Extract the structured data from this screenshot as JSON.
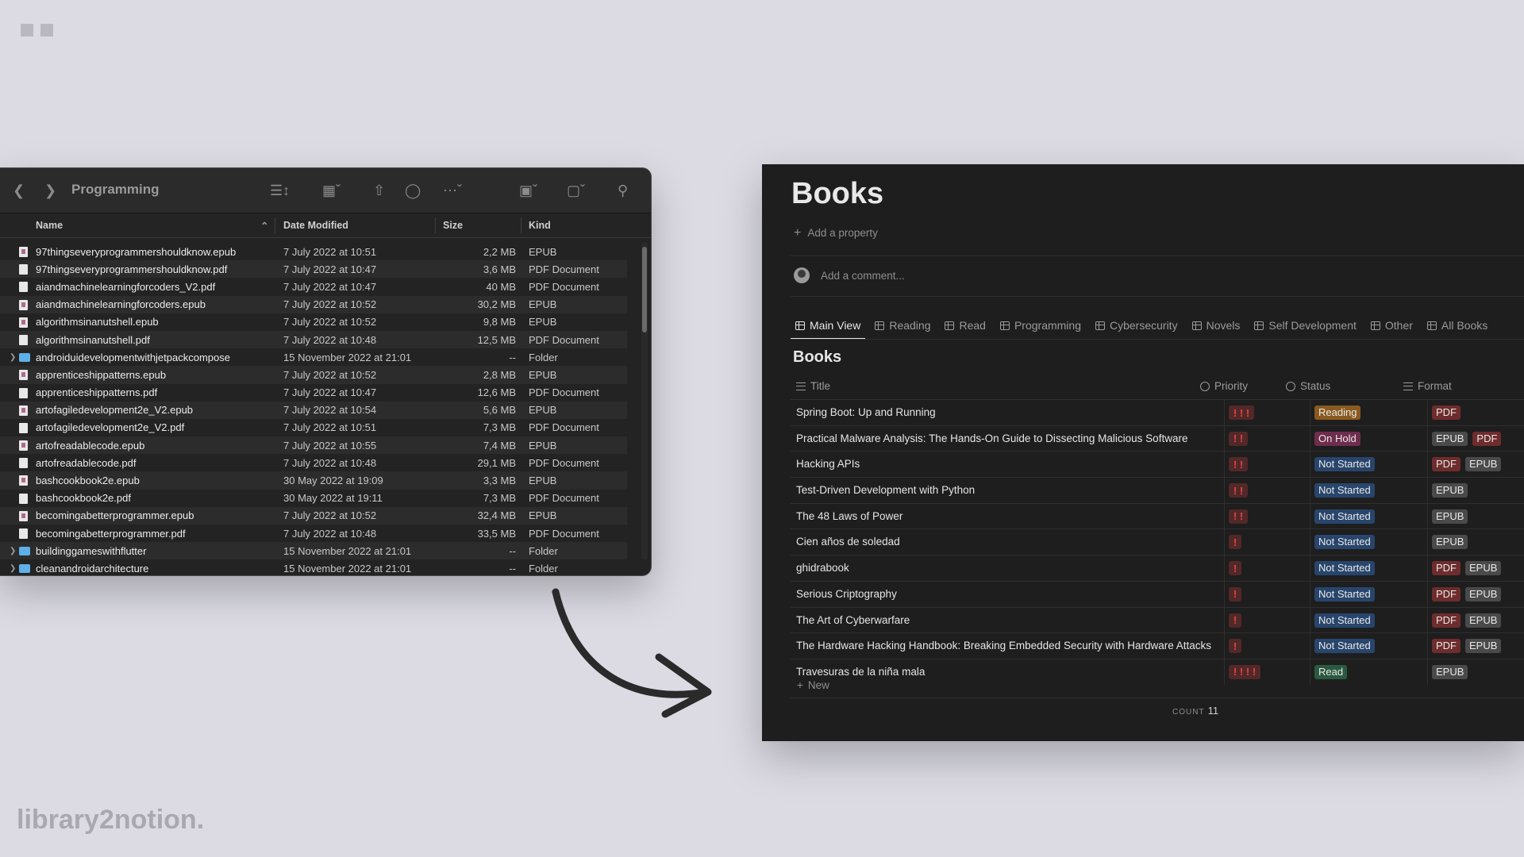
{
  "finder": {
    "title": "Programming",
    "columns": {
      "name": "Name",
      "date": "Date Modified",
      "size": "Size",
      "kind": "Kind"
    },
    "rows": [
      {
        "name": "97thingseveryprogrammershouldknow.epub",
        "date": "7 July 2022 at 10:51",
        "size": "2,2 MB",
        "kind": "EPUB",
        "type": "epub"
      },
      {
        "name": "97thingseveryprogrammershouldknow.pdf",
        "date": "7 July 2022 at 10:47",
        "size": "3,6 MB",
        "kind": "PDF Document",
        "type": "pdf"
      },
      {
        "name": "aiandmachinelearningforcoders_V2.pdf",
        "date": "7 July 2022 at 10:47",
        "size": "40 MB",
        "kind": "PDF Document",
        "type": "pdf"
      },
      {
        "name": "aiandmachinelearningforcoders.epub",
        "date": "7 July 2022 at 10:52",
        "size": "30,2 MB",
        "kind": "EPUB",
        "type": "epub"
      },
      {
        "name": "algorithmsinanutshell.epub",
        "date": "7 July 2022 at 10:52",
        "size": "9,8 MB",
        "kind": "EPUB",
        "type": "epub"
      },
      {
        "name": "algorithmsinanutshell.pdf",
        "date": "7 July 2022 at 10:48",
        "size": "12,5 MB",
        "kind": "PDF Document",
        "type": "pdf"
      },
      {
        "name": "androiduidevelopmentwithjetpackcompose",
        "date": "15 November 2022 at 21:01",
        "size": "--",
        "kind": "Folder",
        "type": "folder"
      },
      {
        "name": "apprenticeshippatterns.epub",
        "date": "7 July 2022 at 10:52",
        "size": "2,8 MB",
        "kind": "EPUB",
        "type": "epub"
      },
      {
        "name": "apprenticeshippatterns.pdf",
        "date": "7 July 2022 at 10:47",
        "size": "12,6 MB",
        "kind": "PDF Document",
        "type": "pdf"
      },
      {
        "name": "artofagiledevelopment2e_V2.epub",
        "date": "7 July 2022 at 10:54",
        "size": "5,6 MB",
        "kind": "EPUB",
        "type": "epub"
      },
      {
        "name": "artofagiledevelopment2e_V2.pdf",
        "date": "7 July 2022 at 10:51",
        "size": "7,3 MB",
        "kind": "PDF Document",
        "type": "pdf"
      },
      {
        "name": "artofreadablecode.epub",
        "date": "7 July 2022 at 10:55",
        "size": "7,4 MB",
        "kind": "EPUB",
        "type": "epub"
      },
      {
        "name": "artofreadablecode.pdf",
        "date": "7 July 2022 at 10:48",
        "size": "29,1 MB",
        "kind": "PDF Document",
        "type": "pdf"
      },
      {
        "name": "bashcookbook2e.epub",
        "date": "30 May 2022 at 19:09",
        "size": "3,3 MB",
        "kind": "EPUB",
        "type": "epub"
      },
      {
        "name": "bashcookbook2e.pdf",
        "date": "30 May 2022 at 19:11",
        "size": "7,3 MB",
        "kind": "PDF Document",
        "type": "pdf"
      },
      {
        "name": "becomingabetterprogrammer.epub",
        "date": "7 July 2022 at 10:52",
        "size": "32,4 MB",
        "kind": "EPUB",
        "type": "epub"
      },
      {
        "name": "becomingabetterprogrammer.pdf",
        "date": "7 July 2022 at 10:48",
        "size": "33,5 MB",
        "kind": "PDF Document",
        "type": "pdf"
      },
      {
        "name": "buildinggameswithflutter",
        "date": "15 November 2022 at 21:01",
        "size": "--",
        "kind": "Folder",
        "type": "folder"
      },
      {
        "name": "cleanandroidarchitecture",
        "date": "15 November 2022 at 21:01",
        "size": "--",
        "kind": "Folder",
        "type": "folder"
      }
    ]
  },
  "notion": {
    "title": "Books",
    "add_property": "Add a property",
    "add_comment": "Add a comment...",
    "tabs": [
      "Main View",
      "Reading",
      "Read",
      "Programming",
      "Cybersecurity",
      "Novels",
      "Self Development",
      "Other",
      "All Books"
    ],
    "db_title": "Books",
    "columns": {
      "title": "Title",
      "priority": "Priority",
      "status": "Status",
      "format": "Format"
    },
    "rows": [
      {
        "title": "Spring Boot: Up and Running",
        "priority": 3,
        "status": "Reading",
        "formats": [
          "PDF"
        ]
      },
      {
        "title": "Practical Malware Analysis: The Hands-On Guide to Dissecting Malicious Software",
        "priority": 2,
        "status": "On Hold",
        "formats": [
          "EPUB",
          "PDF"
        ]
      },
      {
        "title": "Hacking APIs",
        "priority": 2,
        "status": "Not Started",
        "formats": [
          "PDF",
          "EPUB"
        ]
      },
      {
        "title": "Test-Driven Development with Python",
        "priority": 2,
        "status": "Not Started",
        "formats": [
          "EPUB"
        ]
      },
      {
        "title": "The 48 Laws of Power",
        "priority": 2,
        "status": "Not Started",
        "formats": [
          "EPUB"
        ]
      },
      {
        "title": "Cien años de soledad",
        "priority": 1,
        "status": "Not Started",
        "formats": [
          "EPUB"
        ]
      },
      {
        "title": "ghidrabook",
        "priority": 1,
        "status": "Not Started",
        "formats": [
          "PDF",
          "EPUB"
        ]
      },
      {
        "title": "Serious Criptography",
        "priority": 1,
        "status": "Not Started",
        "formats": [
          "PDF",
          "EPUB"
        ]
      },
      {
        "title": "The Art of Cyberwarfare",
        "priority": 1,
        "status": "Not Started",
        "formats": [
          "PDF",
          "EPUB"
        ]
      },
      {
        "title": "The Hardware Hacking Handbook: Breaking Embedded Security with Hardware Attacks",
        "priority": 1,
        "status": "Not Started",
        "formats": [
          "PDF",
          "EPUB"
        ]
      },
      {
        "title": "Travesuras de la niña mala",
        "priority": 4,
        "status": "Read",
        "formats": [
          "EPUB"
        ]
      }
    ],
    "priority_glyph": "!",
    "new_label": "New",
    "count_label": "COUNT",
    "count_value": "11"
  },
  "colors": {
    "status": {
      "Reading": "#8a5a1f",
      "On Hold": "#6e2d4c",
      "Not Started": "#28456c",
      "Read": "#2b593f"
    },
    "format": {
      "PDF": "#6e2c2c",
      "EPUB": "#4a4a4a"
    }
  },
  "brand": "library2notion."
}
